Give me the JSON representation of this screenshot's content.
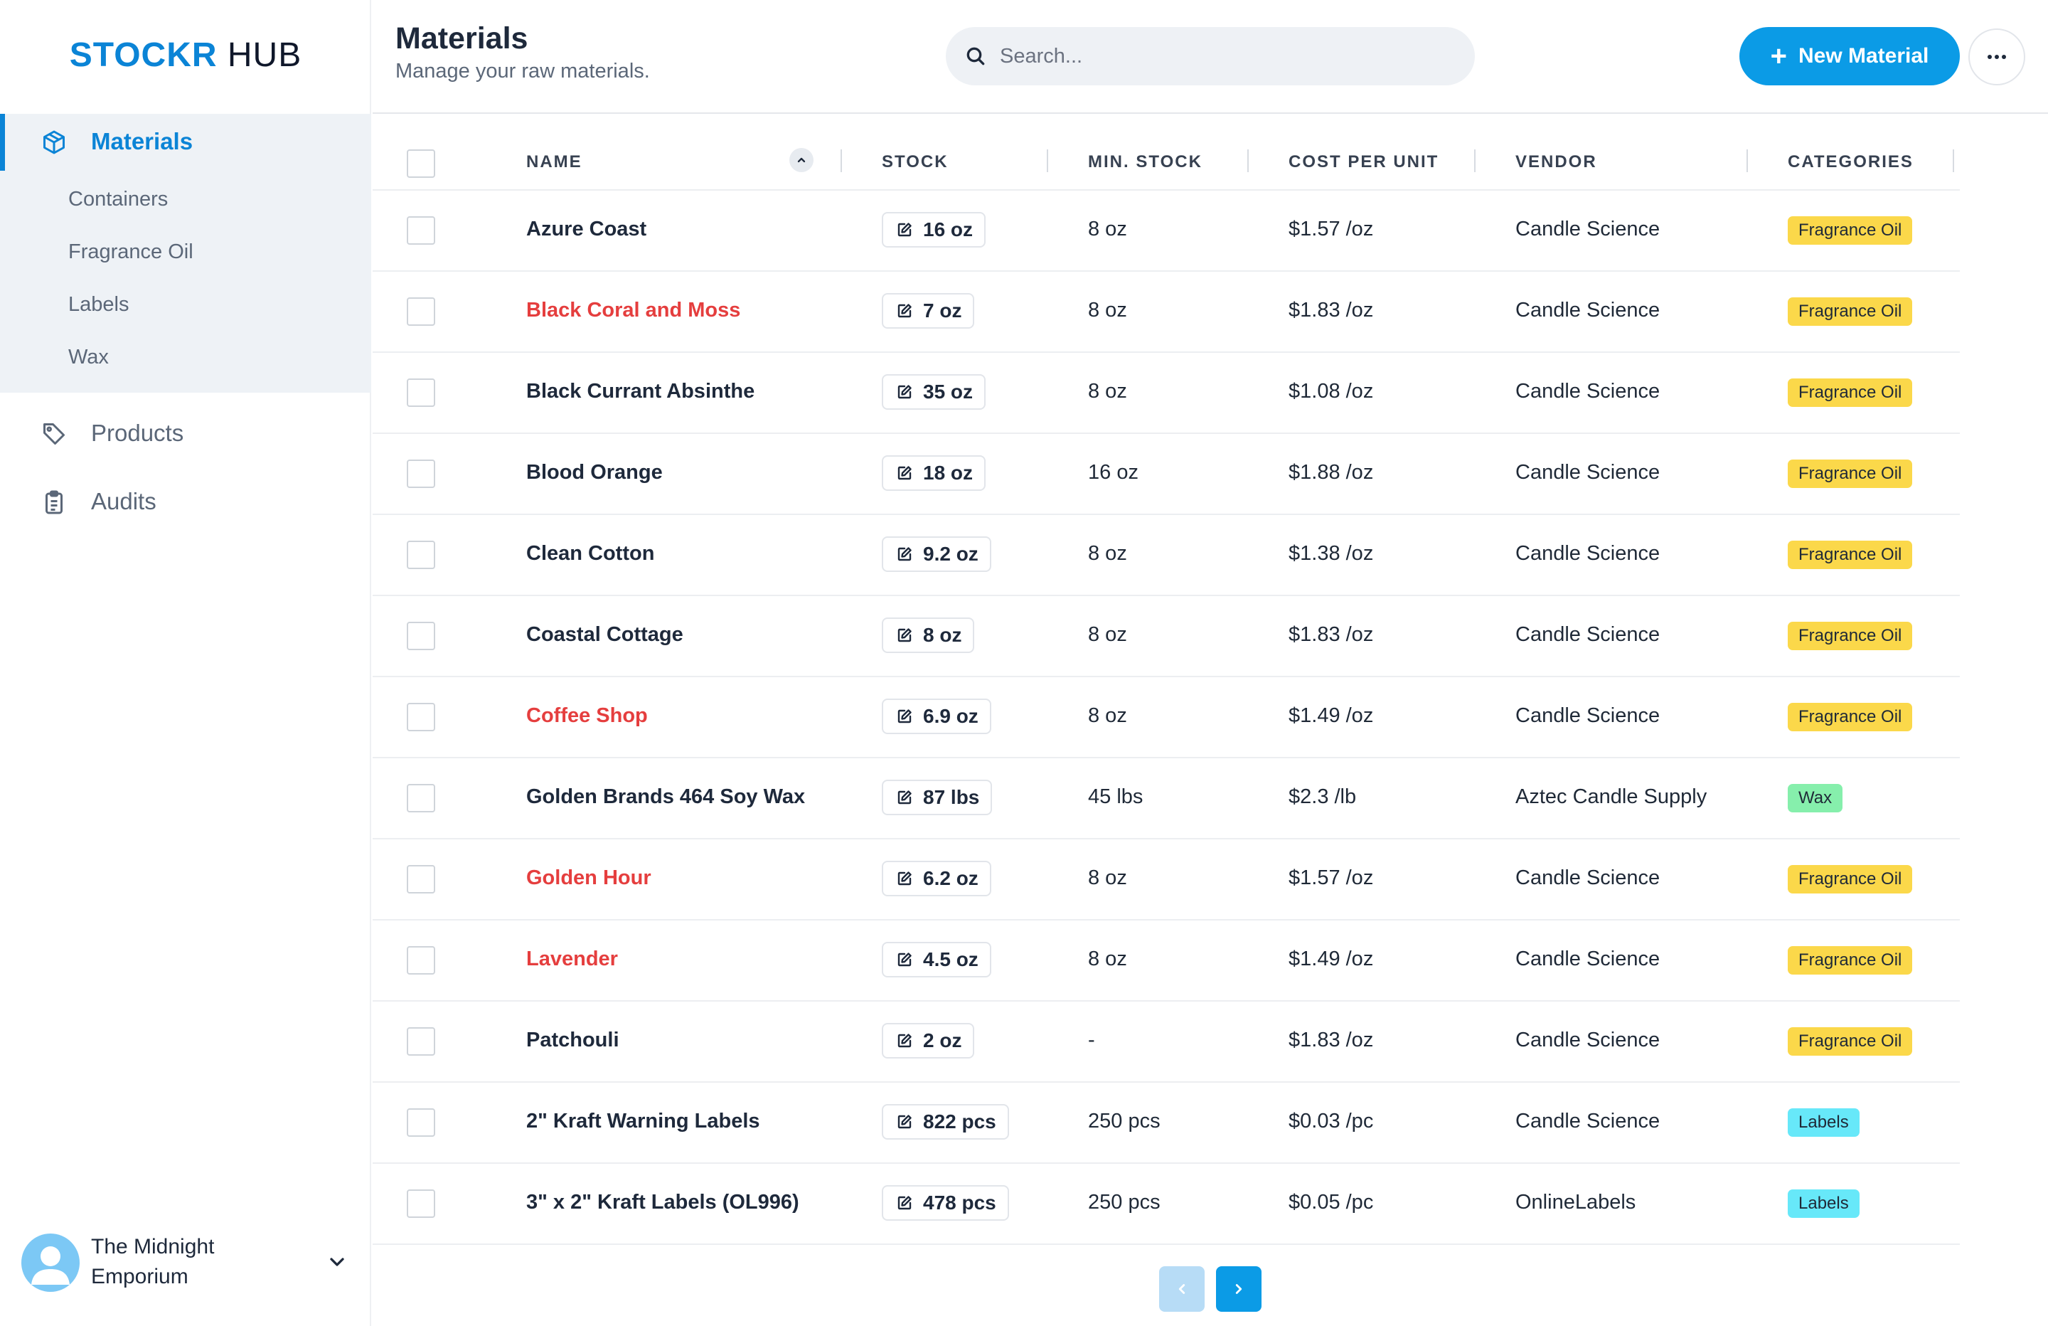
{
  "brand": {
    "part1": "STOCKR",
    "part2": "HUB"
  },
  "colors": {
    "accent": "#0b84d6",
    "button": "#0b9be6",
    "low_stock": "#e53e3e"
  },
  "sidebar": {
    "active": {
      "label": "Materials",
      "icon": "cube-icon"
    },
    "sub_items": [
      "Containers",
      "Fragrance Oil",
      "Labels",
      "Wax"
    ],
    "items": [
      {
        "label": "Products",
        "icon": "tag-icon"
      },
      {
        "label": "Audits",
        "icon": "clipboard-icon"
      }
    ],
    "account": {
      "name": "The Midnight Emporium"
    }
  },
  "header": {
    "title": "Materials",
    "subtitle": "Manage your raw materials.",
    "search_placeholder": "Search...",
    "new_button": "New Material"
  },
  "table": {
    "columns": [
      "NAME",
      "STOCK",
      "MIN. STOCK",
      "COST PER UNIT",
      "VENDOR",
      "CATEGORIES"
    ],
    "rows": [
      {
        "name": "Azure Coast",
        "low": false,
        "stock": "16 oz",
        "min": "8 oz",
        "cost": "$1.57 /oz",
        "vendor": "Candle Science",
        "category": "Fragrance Oil",
        "cat_color": "#fbd84a"
      },
      {
        "name": "Black Coral and Moss",
        "low": true,
        "stock": "7 oz",
        "min": "8 oz",
        "cost": "$1.83 /oz",
        "vendor": "Candle Science",
        "category": "Fragrance Oil",
        "cat_color": "#fbd84a"
      },
      {
        "name": "Black Currant Absinthe",
        "low": false,
        "stock": "35 oz",
        "min": "8 oz",
        "cost": "$1.08 /oz",
        "vendor": "Candle Science",
        "category": "Fragrance Oil",
        "cat_color": "#fbd84a"
      },
      {
        "name": "Blood Orange",
        "low": false,
        "stock": "18 oz",
        "min": "16 oz",
        "cost": "$1.88 /oz",
        "vendor": "Candle Science",
        "category": "Fragrance Oil",
        "cat_color": "#fbd84a"
      },
      {
        "name": "Clean Cotton",
        "low": false,
        "stock": "9.2 oz",
        "min": "8 oz",
        "cost": "$1.38 /oz",
        "vendor": "Candle Science",
        "category": "Fragrance Oil",
        "cat_color": "#fbd84a"
      },
      {
        "name": "Coastal Cottage",
        "low": false,
        "stock": "8 oz",
        "min": "8 oz",
        "cost": "$1.83 /oz",
        "vendor": "Candle Science",
        "category": "Fragrance Oil",
        "cat_color": "#fbd84a"
      },
      {
        "name": "Coffee Shop",
        "low": true,
        "stock": "6.9 oz",
        "min": "8 oz",
        "cost": "$1.49 /oz",
        "vendor": "Candle Science",
        "category": "Fragrance Oil",
        "cat_color": "#fbd84a"
      },
      {
        "name": "Golden Brands 464 Soy Wax",
        "low": false,
        "stock": "87 lbs",
        "min": "45 lbs",
        "cost": "$2.3 /lb",
        "vendor": "Aztec Candle Supply",
        "category": "Wax",
        "cat_color": "#86efac"
      },
      {
        "name": "Golden Hour",
        "low": true,
        "stock": "6.2 oz",
        "min": "8 oz",
        "cost": "$1.57 /oz",
        "vendor": "Candle Science",
        "category": "Fragrance Oil",
        "cat_color": "#fbd84a"
      },
      {
        "name": "Lavender",
        "low": true,
        "stock": "4.5 oz",
        "min": "8 oz",
        "cost": "$1.49 /oz",
        "vendor": "Candle Science",
        "category": "Fragrance Oil",
        "cat_color": "#fbd84a"
      },
      {
        "name": "Patchouli",
        "low": false,
        "stock": "2 oz",
        "min": "-",
        "cost": "$1.83 /oz",
        "vendor": "Candle Science",
        "category": "Fragrance Oil",
        "cat_color": "#fbd84a"
      },
      {
        "name": "2\" Kraft Warning Labels",
        "low": false,
        "stock": "822 pcs",
        "min": "250 pcs",
        "cost": "$0.03 /pc",
        "vendor": "Candle Science",
        "category": "Labels",
        "cat_color": "#67e8f9"
      },
      {
        "name": "3\" x 2\" Kraft Labels (OL996)",
        "low": false,
        "stock": "478 pcs",
        "min": "250 pcs",
        "cost": "$0.05 /pc",
        "vendor": "OnlineLabels",
        "category": "Labels",
        "cat_color": "#67e8f9"
      }
    ]
  }
}
